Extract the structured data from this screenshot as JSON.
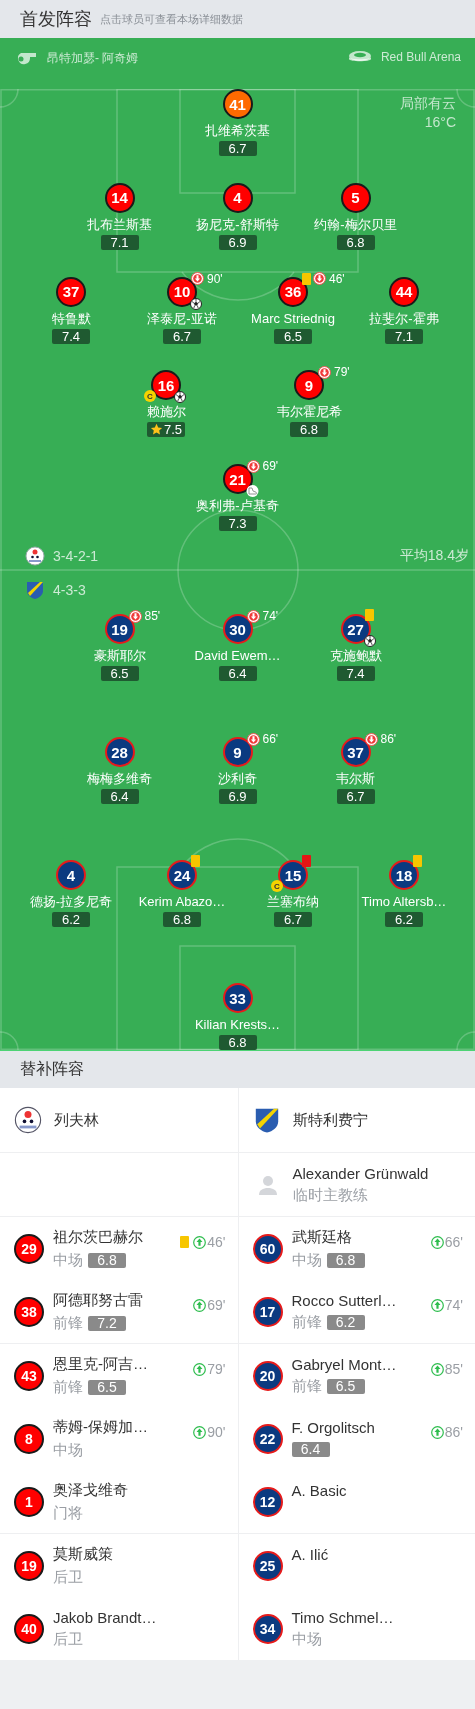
{
  "header": {
    "title": "首发阵容",
    "hint": "点击球员可查看本场详细数据"
  },
  "pitch": {
    "referee": "昂特加瑟- 阿奇姆",
    "stadium": "Red Bull Arena",
    "weather": {
      "condition": "局部有云",
      "temperature": "16°C"
    },
    "teams": [
      {
        "kind": "home",
        "formation": "3-4-2-1",
        "average_age": "平均18.4岁",
        "lines": [
          [
            {
              "number": "41",
              "name": "扎维希茨基",
              "rating": "6.7",
              "color": "#ff6a00"
            }
          ],
          [
            {
              "number": "14",
              "name": "扎布兰斯基",
              "rating": "7.1",
              "color": "#ff0000"
            },
            {
              "number": "4",
              "name": "扬尼克-舒斯特",
              "rating": "6.9",
              "color": "#ff0000"
            },
            {
              "number": "5",
              "name": "约翰-梅尔贝里",
              "rating": "6.8",
              "color": "#ff0000"
            }
          ],
          [
            {
              "number": "37",
              "name": "特鲁默",
              "rating": "7.4",
              "color": "#ff0000"
            },
            {
              "number": "10",
              "name": "泽泰尼-亚诺",
              "rating": "6.7",
              "color": "#ff0000",
              "events": [
                {
                  "kind": "sub_off",
                  "minute": "90'"
                },
                {
                  "kind": "goal"
                }
              ]
            },
            {
              "number": "36",
              "name": "Marc Striednig",
              "rating": "6.5",
              "color": "#ff0000",
              "events": [
                {
                  "kind": "yellow"
                },
                {
                  "kind": "sub_off",
                  "minute": "46'"
                }
              ]
            },
            {
              "number": "44",
              "name": "拉斐尔-霍弗",
              "rating": "7.1",
              "color": "#ff0000"
            }
          ],
          [
            {
              "number": "16",
              "name": "赖施尔",
              "rating": "7.5",
              "color": "#ff0000",
              "events": [
                {
                  "kind": "captain",
                  "label": "C"
                },
                {
                  "kind": "goal"
                },
                {
                  "kind": "best"
                }
              ]
            },
            {
              "number": "9",
              "name": "韦尔霍尼希",
              "rating": "6.8",
              "color": "#ff0000",
              "events": [
                {
                  "kind": "sub_off",
                  "minute": "79'"
                }
              ]
            }
          ],
          [
            {
              "number": "21",
              "name": "奥利弗-卢基奇",
              "rating": "7.3",
              "color": "#ff0000",
              "events": [
                {
                  "kind": "sub_off",
                  "minute": "69'"
                },
                {
                  "kind": "assist"
                }
              ]
            }
          ]
        ]
      },
      {
        "kind": "away",
        "formation": "4-3-3",
        "lines": [
          [
            {
              "number": "19",
              "name": "豪斯耶尔",
              "rating": "6.5",
              "color": "#0b3a80",
              "events": [
                {
                  "kind": "sub_off",
                  "minute": "85'"
                }
              ]
            },
            {
              "number": "30",
              "name": "David Ewem…",
              "rating": "6.4",
              "color": "#0b3a80",
              "events": [
                {
                  "kind": "sub_off",
                  "minute": "74'"
                }
              ]
            },
            {
              "number": "27",
              "name": "克施鲍默",
              "rating": "7.4",
              "color": "#0b3a80",
              "events": [
                {
                  "kind": "yellow"
                },
                {
                  "kind": "goal"
                }
              ]
            }
          ],
          [
            {
              "number": "28",
              "name": "梅梅多维奇",
              "rating": "6.4",
              "color": "#0b3a80"
            },
            {
              "number": "9",
              "name": "沙利奇",
              "rating": "6.9",
              "color": "#0b3a80",
              "events": [
                {
                  "kind": "sub_off",
                  "minute": "66'"
                }
              ]
            },
            {
              "number": "37",
              "name": "韦尔斯",
              "rating": "6.7",
              "color": "#0b3a80",
              "events": [
                {
                  "kind": "sub_off",
                  "minute": "86'"
                }
              ]
            }
          ],
          [
            {
              "number": "4",
              "name": "德扬-拉多尼奇",
              "rating": "6.2",
              "color": "#0b3a80"
            },
            {
              "number": "24",
              "name": "Kerim Abazo…",
              "rating": "6.8",
              "color": "#0b3a80",
              "events": [
                {
                  "kind": "yellow"
                }
              ]
            },
            {
              "number": "15",
              "name": "兰塞布纳",
              "rating": "6.7",
              "color": "#0b3a80",
              "events": [
                {
                  "kind": "red"
                },
                {
                  "kind": "captain",
                  "label": "C"
                }
              ]
            },
            {
              "number": "18",
              "name": "Timo Altersb…",
              "rating": "6.2",
              "color": "#0b3a80",
              "events": [
                {
                  "kind": "yellow"
                }
              ]
            }
          ],
          [
            {
              "number": "33",
              "name": "Kilian Krests…",
              "rating": "6.8",
              "color": "#0b3a80"
            }
          ]
        ]
      }
    ]
  },
  "bench": {
    "title": "替补阵容",
    "teams": [
      {
        "kind": "home",
        "name": "列夫林"
      },
      {
        "kind": "away",
        "name": "斯特利费宁"
      }
    ],
    "coach": {
      "name": "Alexander Grünwald",
      "role": "临时主教练"
    },
    "groups": [
      {
        "rows": [
          {
            "home": {
              "number": "29",
              "name": "祖尔茨巴赫尔",
              "position": "中场",
              "rating": "6.8",
              "events": [
                {
                  "kind": "yellow"
                },
                {
                  "kind": "sub_on",
                  "minute": "46'"
                }
              ]
            },
            "away": {
              "number": "60",
              "name": "武斯廷格",
              "position": "中场",
              "rating": "6.8",
              "events": [
                {
                  "kind": "sub_on",
                  "minute": "66'"
                }
              ]
            }
          },
          {
            "home": {
              "number": "38",
              "name": "阿德耶努古雷",
              "position": "前锋",
              "rating": "7.2",
              "events": [
                {
                  "kind": "sub_on",
                  "minute": "69'"
                }
              ]
            },
            "away": {
              "number": "17",
              "name": "Rocco Sutterl…",
              "position": "前锋",
              "rating": "6.2",
              "events": [
                {
                  "kind": "sub_on",
                  "minute": "74'"
                }
              ]
            }
          }
        ]
      },
      {
        "rows": [
          {
            "home": {
              "number": "43",
              "name": "恩里克-阿吉…",
              "position": "前锋",
              "rating": "6.5",
              "events": [
                {
                  "kind": "sub_on",
                  "minute": "79'"
                }
              ]
            },
            "away": {
              "number": "20",
              "name": "Gabryel Mont…",
              "position": "前锋",
              "rating": "6.5",
              "events": [
                {
                  "kind": "sub_on",
                  "minute": "85'"
                }
              ]
            }
          },
          {
            "home": {
              "number": "8",
              "name": "蒂姆-保姆加…",
              "position": "中场",
              "events": [
                {
                  "kind": "sub_on",
                  "minute": "90'"
                }
              ]
            },
            "away": {
              "number": "22",
              "name": "F. Orgolitsch",
              "rating": "6.4",
              "events": [
                {
                  "kind": "sub_on",
                  "minute": "86'"
                }
              ]
            }
          },
          {
            "home": {
              "number": "1",
              "name": "奥泽戈维奇",
              "position": "门将"
            },
            "away": {
              "number": "12",
              "name": "A. Basic"
            }
          }
        ]
      },
      {
        "rows": [
          {
            "home": {
              "number": "19",
              "name": "莫斯威策",
              "position": "后卫"
            },
            "away": {
              "number": "25",
              "name": "A. Ilić"
            }
          },
          {
            "home": {
              "number": "40",
              "name": "Jakob Brandt…",
              "position": "后卫"
            },
            "away": {
              "number": "34",
              "name": "Timo Schmel…",
              "position": "中场"
            }
          }
        ]
      }
    ]
  }
}
